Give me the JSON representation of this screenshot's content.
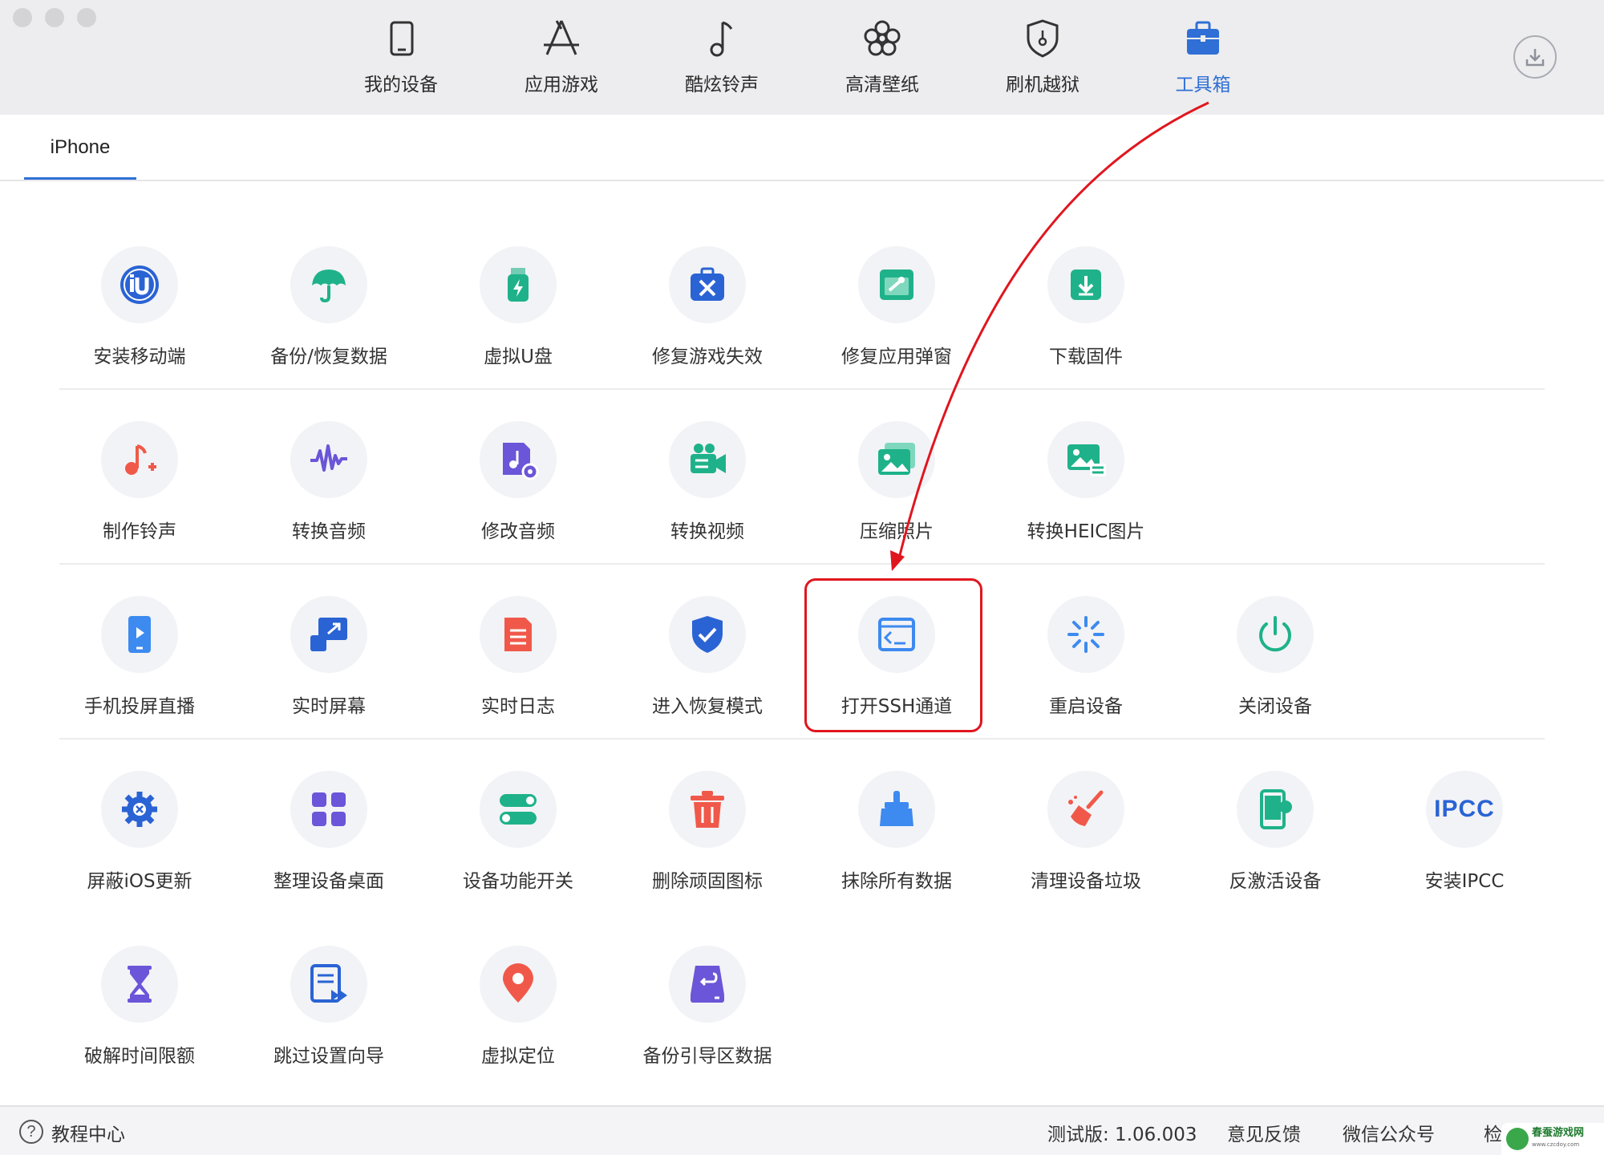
{
  "nav": {
    "items": [
      {
        "label": "我的设备",
        "icon": "phone-icon"
      },
      {
        "label": "应用游戏",
        "icon": "app-store-icon"
      },
      {
        "label": "酷炫铃声",
        "icon": "music-note-icon"
      },
      {
        "label": "高清壁纸",
        "icon": "flower-icon"
      },
      {
        "label": "刷机越狱",
        "icon": "shield-key-icon"
      },
      {
        "label": "工具箱",
        "icon": "toolbox-icon",
        "active": true
      }
    ],
    "download_icon": "download-icon",
    "active_color": "#2f6fd6"
  },
  "tab": {
    "label": "iPhone"
  },
  "tools": [
    {
      "label": "安装移动端",
      "icon": "iu-logo-icon"
    },
    {
      "label": "备份/恢复数据",
      "icon": "umbrella-icon"
    },
    {
      "label": "虚拟U盘",
      "icon": "usb-drive-icon"
    },
    {
      "label": "修复游戏失效",
      "icon": "repair-kit-icon"
    },
    {
      "label": "修复应用弹窗",
      "icon": "window-wrench-icon"
    },
    {
      "label": "下载固件",
      "icon": "download-box-icon"
    },
    {
      "label": "制作铃声",
      "icon": "ringtone-plus-icon"
    },
    {
      "label": "转换音频",
      "icon": "waveform-icon"
    },
    {
      "label": "修改音频",
      "icon": "audio-file-gear-icon"
    },
    {
      "label": "转换视频",
      "icon": "video-camera-icon"
    },
    {
      "label": "压缩照片",
      "icon": "photo-stack-icon"
    },
    {
      "label": "转换HEIC图片",
      "icon": "photo-convert-icon"
    },
    {
      "label": "手机投屏直播",
      "icon": "phone-play-icon"
    },
    {
      "label": "实时屏幕",
      "icon": "screen-share-icon"
    },
    {
      "label": "实时日志",
      "icon": "document-icon"
    },
    {
      "label": "进入恢复模式",
      "icon": "shield-check-icon"
    },
    {
      "label": "打开SSH通道",
      "icon": "terminal-icon"
    },
    {
      "label": "重启设备",
      "icon": "restart-spinner-icon"
    },
    {
      "label": "关闭设备",
      "icon": "power-icon"
    },
    {
      "label": "屏蔽iOS更新",
      "icon": "gear-block-icon"
    },
    {
      "label": "整理设备桌面",
      "icon": "app-grid-icon"
    },
    {
      "label": "设备功能开关",
      "icon": "toggles-icon"
    },
    {
      "label": "删除顽固图标",
      "icon": "trash-icon"
    },
    {
      "label": "抹除所有数据",
      "icon": "broom-icon"
    },
    {
      "label": "清理设备垃圾",
      "icon": "brush-clean-icon"
    },
    {
      "label": "反激活设备",
      "icon": "phone-deactivate-icon"
    },
    {
      "label": "安装IPCC",
      "icon": "ipcc-icon",
      "text": "IPCC"
    },
    {
      "label": "破解时间限额",
      "icon": "hourglass-icon"
    },
    {
      "label": "跳过设置向导",
      "icon": "skip-setup-icon"
    },
    {
      "label": "虚拟定位",
      "icon": "location-pin-icon"
    },
    {
      "label": "备份引导区数据",
      "icon": "drive-backup-icon"
    }
  ],
  "annotation": {
    "highlight_color": "#e0161f"
  },
  "footer": {
    "help_label": "教程中心",
    "help_icon": "question-circle-icon",
    "version": "测试版: 1.06.003",
    "feedback": "意见反馈",
    "wechat": "微信公众号",
    "check_update": "检",
    "watermark_title": "春蚕游戏网",
    "watermark_url": "www.czcdoy.com"
  }
}
